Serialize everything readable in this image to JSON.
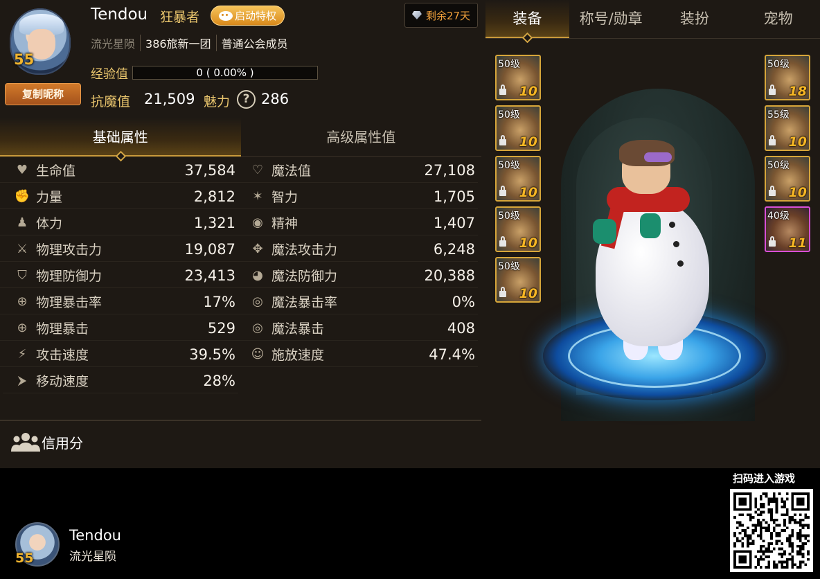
{
  "profile": {
    "name": "Tendou",
    "job": "狂暴者",
    "privilege_label": "启动特权",
    "level": "55",
    "copy_nickname_label": "复制昵称",
    "server": "流光星陨",
    "guild": "386旅新一团",
    "guild_role": "普通公会成员",
    "exp_label": "经验值",
    "exp_text": "0 ( 0.00% )",
    "exp_progress": 0,
    "anti_magic_label": "抗魔值",
    "anti_magic_value": "21,509",
    "charm_label": "魅力",
    "charm_value": "286",
    "remaining_label": "剩余27天"
  },
  "attr_tabs": [
    {
      "label": "基础属性",
      "active": true
    },
    {
      "label": "高级属性值",
      "active": false
    }
  ],
  "stats_left": [
    {
      "icon": "heart-icon",
      "glyph": "♥",
      "label": "生命值",
      "value": "37,584"
    },
    {
      "icon": "fist-icon",
      "glyph": "✊",
      "label": "力量",
      "value": "2,812"
    },
    {
      "icon": "body-icon",
      "glyph": "♟",
      "label": "体力",
      "value": "1,321"
    },
    {
      "icon": "sword-icon",
      "glyph": "⚔",
      "label": "物理攻击力",
      "value": "19,087"
    },
    {
      "icon": "shield-icon",
      "glyph": "⛉",
      "label": "物理防御力",
      "value": "23,413"
    },
    {
      "icon": "crosshair-icon",
      "glyph": "⊕",
      "label": "物理暴击率",
      "value": "17%"
    },
    {
      "icon": "crosshair-icon",
      "glyph": "⊕",
      "label": "物理暴击",
      "value": "529"
    },
    {
      "icon": "attack-speed-icon",
      "glyph": "⚡",
      "label": "攻击速度",
      "value": "39.5%"
    },
    {
      "icon": "boot-icon",
      "glyph": "⮞",
      "label": "移动速度",
      "value": "28%"
    }
  ],
  "stats_right": [
    {
      "icon": "heart-outline-icon",
      "glyph": "♡",
      "label": "魔法值",
      "value": "27,108"
    },
    {
      "icon": "sparkle-icon",
      "glyph": "✶",
      "label": "智力",
      "value": "1,705"
    },
    {
      "icon": "spirit-icon",
      "glyph": "◉",
      "label": "精神",
      "value": "1,407"
    },
    {
      "icon": "magic-attack-icon",
      "glyph": "✥",
      "label": "魔法攻击力",
      "value": "6,248"
    },
    {
      "icon": "magic-defense-icon",
      "glyph": "◕",
      "label": "魔法防御力",
      "value": "20,388"
    },
    {
      "icon": "target-icon",
      "glyph": "◎",
      "label": "魔法暴击率",
      "value": "0%"
    },
    {
      "icon": "target-icon",
      "glyph": "◎",
      "label": "魔法暴击",
      "value": "408"
    },
    {
      "icon": "head-icon",
      "glyph": "☺",
      "label": "施放速度",
      "value": "47.4%"
    }
  ],
  "credit_label": "信用分",
  "right_tabs": [
    {
      "label": "装备",
      "active": true
    },
    {
      "label": "称号/勋章",
      "active": false
    },
    {
      "label": "装扮",
      "active": false
    },
    {
      "label": "宠物",
      "active": false
    }
  ],
  "equipment_left": [
    {
      "level": "50级",
      "enhance": "10",
      "rarity": "legendary",
      "icon": "shoulder-armor-icon"
    },
    {
      "level": "50级",
      "enhance": "10",
      "rarity": "legendary",
      "icon": "chest-armor-icon"
    },
    {
      "level": "50级",
      "enhance": "10",
      "rarity": "legendary",
      "icon": "leg-armor-icon"
    },
    {
      "level": "50级",
      "enhance": "10",
      "rarity": "legendary",
      "icon": "belt-icon"
    },
    {
      "level": "50级",
      "enhance": "10",
      "rarity": "legendary",
      "icon": "boots-icon"
    }
  ],
  "equipment_right": [
    {
      "level": "50级",
      "enhance": "18",
      "rarity": "legendary",
      "icon": "weapon-icon"
    },
    {
      "level": "55级",
      "enhance": "10",
      "rarity": "legendary",
      "icon": "bracelet-icon"
    },
    {
      "level": "50级",
      "enhance": "10",
      "rarity": "legendary",
      "icon": "necklace-icon"
    },
    {
      "level": "40级",
      "enhance": "11",
      "rarity": "epic",
      "icon": "ring-icon"
    }
  ],
  "footer": {
    "name": "Tendou",
    "server": "流光星陨",
    "level": "55",
    "scan_label": "扫码进入游戏"
  },
  "colors": {
    "accent_gold": "#c99a3c",
    "stat_label": "#e9c56d",
    "legendary_border": "#d7a63a",
    "epic_border": "#d84fd6"
  }
}
